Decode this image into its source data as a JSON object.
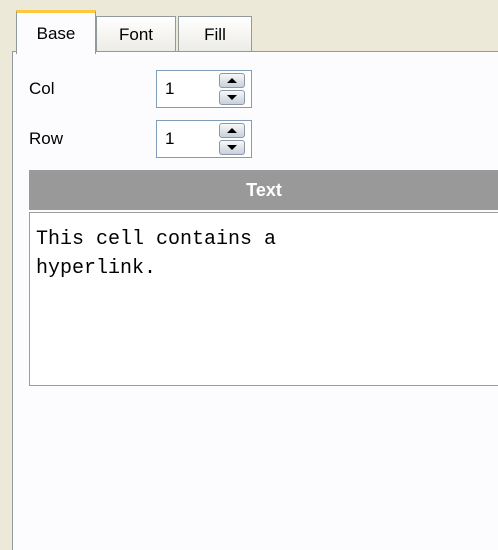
{
  "tabs": [
    {
      "label": "Base",
      "active": true
    },
    {
      "label": "Font",
      "active": false
    },
    {
      "label": "Fill",
      "active": false
    }
  ],
  "fields": {
    "col": {
      "label": "Col",
      "value": "1"
    },
    "row": {
      "label": "Row",
      "value": "1"
    }
  },
  "text_section": {
    "header": "Text",
    "content": "This cell contains a hyperlink."
  },
  "colors": {
    "header_bg": "#999999",
    "active_tab_accent": "#ffc83c",
    "window_bg": "#ece9d8"
  },
  "icons": {
    "spin_up": "up-arrow-icon",
    "spin_down": "down-arrow-icon"
  }
}
